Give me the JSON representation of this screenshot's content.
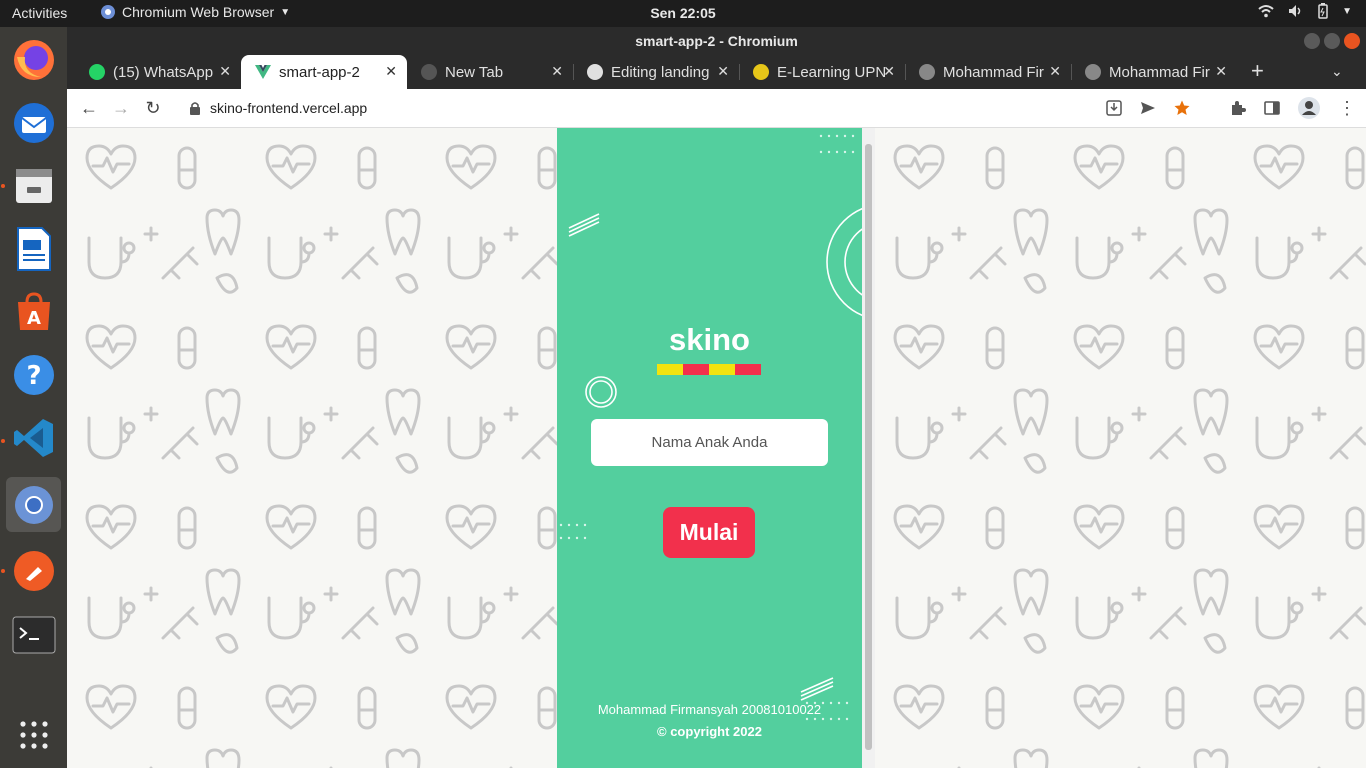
{
  "system": {
    "activities": "Activities",
    "app_menu": "Chromium Web Browser",
    "clock": "Sen 22:05"
  },
  "dock": {
    "items": [
      "firefox-icon",
      "thunderbird-icon",
      "files-icon",
      "writer-icon",
      "software-icon",
      "help-icon",
      "vscode-icon",
      "chromium-icon",
      "postman-icon",
      "terminal-icon",
      "app-grid-icon"
    ]
  },
  "browser": {
    "window_title": "smart-app-2 - Chromium",
    "url": "skino-frontend.vercel.app",
    "tabs": [
      {
        "label": "(15) WhatsApp",
        "icon": "whatsapp-icon",
        "color": "#25d366"
      },
      {
        "label": "smart-app-2",
        "icon": "vue-icon",
        "color": "#41b883"
      },
      {
        "label": "New Tab",
        "icon": "chromium-icon",
        "color": "#666666"
      },
      {
        "label": "Editing landing",
        "icon": "github-icon",
        "color": "#e0e0e0"
      },
      {
        "label": "E-Learning UPN",
        "icon": "upn-icon",
        "color": "#e6c619"
      },
      {
        "label": "Mohammad Fir",
        "icon": "globe-icon",
        "color": "#888888"
      },
      {
        "label": "Mohammad Fir",
        "icon": "globe-icon",
        "color": "#888888"
      }
    ]
  },
  "page": {
    "brand": "skino",
    "brand_bar_colors": [
      "#f2e30f",
      "#f2304c",
      "#f2e30f",
      "#f2304c"
    ],
    "input_placeholder": "Nama Anak Anda",
    "start_label": "Mulai",
    "author": "Mohammad Firmansyah 20081010022",
    "copyright": "© copyright 2022",
    "accent_green": "#53cf9e",
    "accent_red": "#f2304c"
  }
}
